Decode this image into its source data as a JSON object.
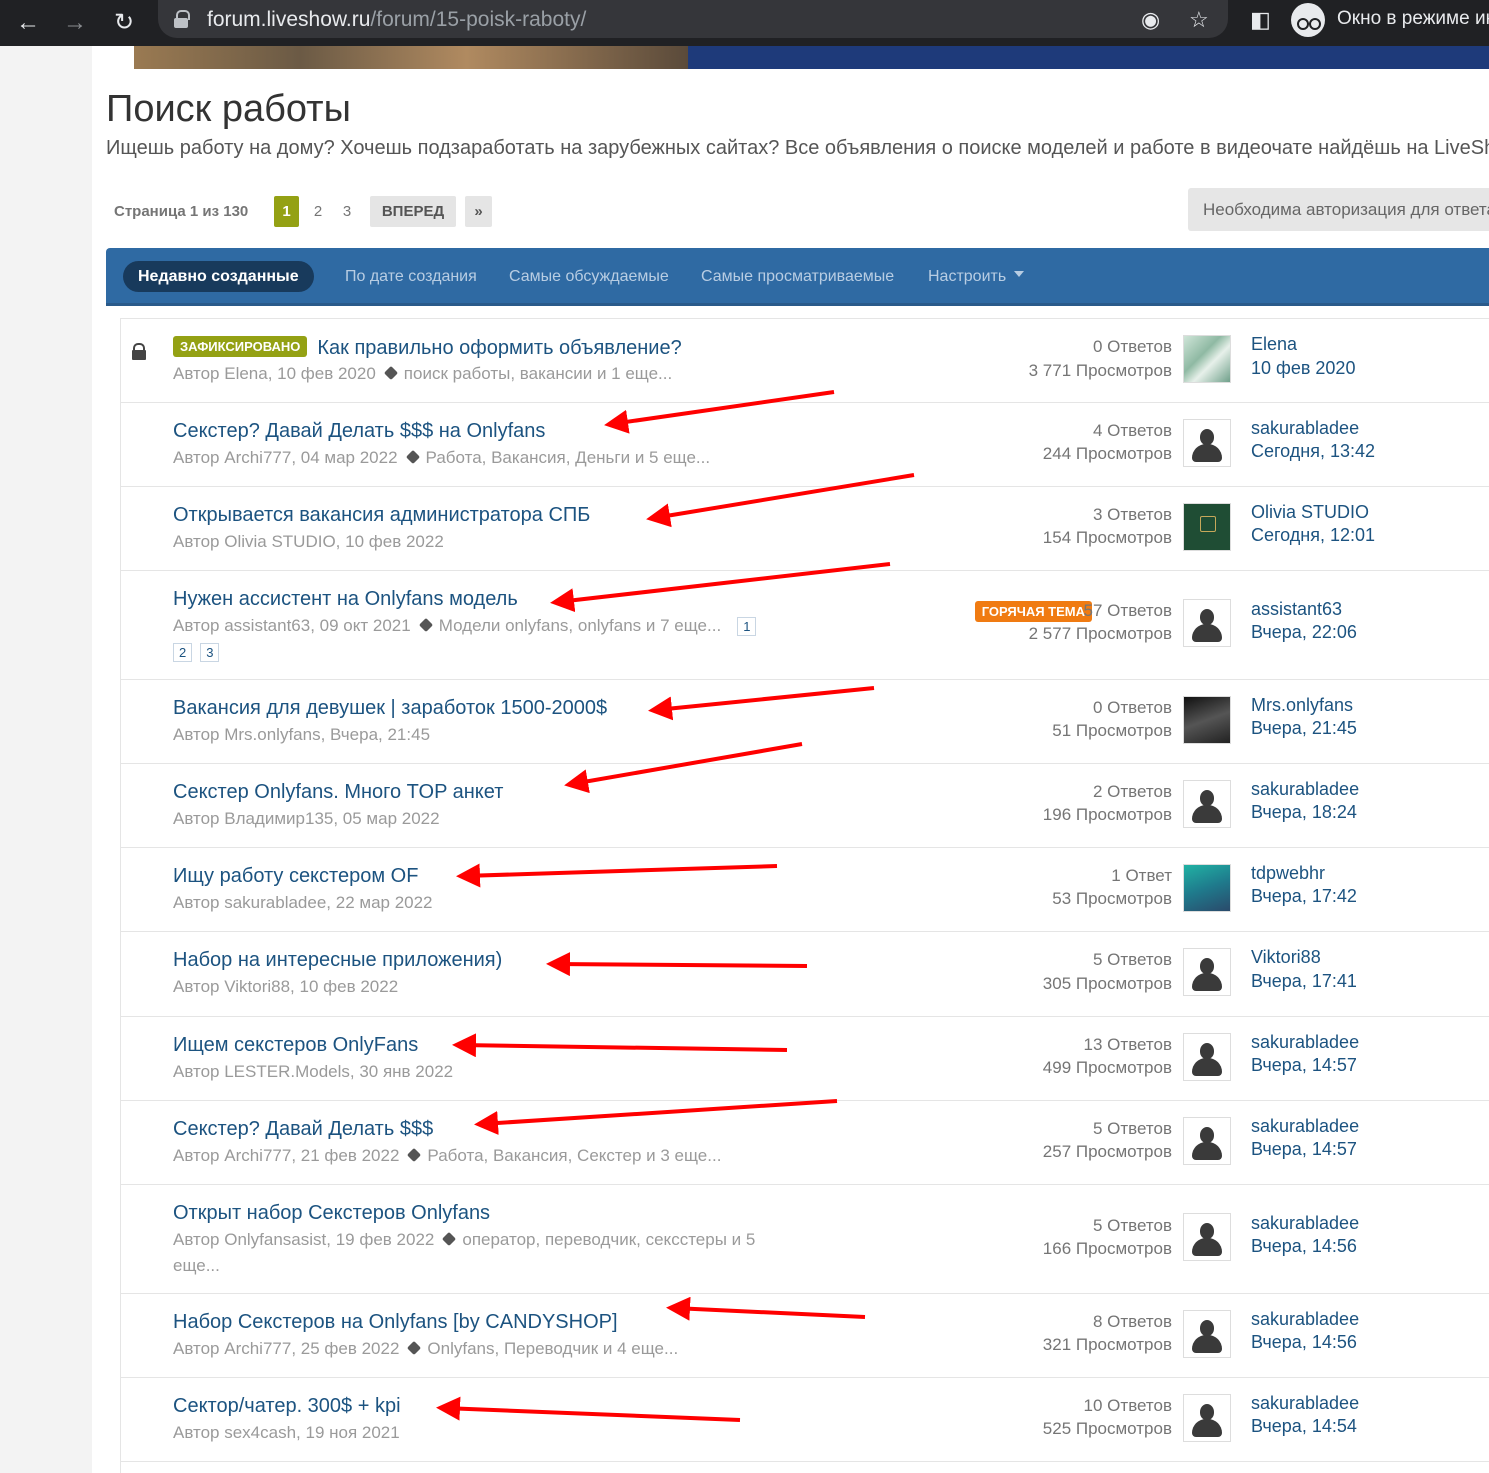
{
  "browser": {
    "url_host": "forum.liveshow.ru",
    "url_path": "/forum/15-poisk-raboty/",
    "incognito_label": "Окно в режиме ин"
  },
  "page": {
    "title": "Поиск работы",
    "description": "Ищешь работу на дому? Хочешь подзаработать на зарубежных сайтах? Все объявления о поиске моделей и работе в видеочате найдёшь на LiveShow"
  },
  "pagination": {
    "info": "Страница 1 из 130",
    "pages": [
      "1",
      "2",
      "3"
    ],
    "next": "ВПЕРЕД",
    "last": "»"
  },
  "auth_button": "Необходима авторизация для ответа",
  "tabs": [
    "Недавно созданные",
    "По дате создания",
    "Самые обсуждаемые",
    "Самые просматриваемые",
    "Настроить"
  ],
  "topics": [
    {
      "pinned": "ЗАФИКСИРОВАНО",
      "title": "Как правильно оформить объявление?",
      "author": "Автор Elena, 10 фев 2020",
      "tags": "поиск работы, вакансии и 1 еще...",
      "replies": "0 Ответов",
      "views": "3 771 Просмотров",
      "last_user": "Elena",
      "last_date": "10 фев 2020",
      "avatar": "leaves-avatar"
    },
    {
      "title": "Секстер? Давай Делать $$$ на Onlyfans",
      "author": "Автор Archi777, 04 мар 2022",
      "tags": "Работа, Вакансия, Деньги и 5 еще...",
      "replies": "4 Ответов",
      "views": "244 Просмотров",
      "last_user": "sakurabladee",
      "last_date": "Сегодня, 13:42",
      "avatar": "default-avatar"
    },
    {
      "title": "Открывается вакансия администратора СПБ",
      "author": "Автор Olivia STUDIO, 10 фев 2022",
      "replies": "3 Ответов",
      "views": "154 Просмотров",
      "last_user": "Olivia STUDIO",
      "last_date": "Сегодня, 12:01",
      "avatar": "studio-logo-avatar"
    },
    {
      "title": "Нужен ассистент на Onlyfans модель",
      "author": "Автор assistant63, 09 окт 2021",
      "tags": "Модели onlyfans, onlyfans и 7 еще...",
      "page_links": [
        "1",
        "2",
        "3"
      ],
      "hot": "ГОРЯЧАЯ ТЕМА",
      "replies": "57 Ответов",
      "views": "2 577 Просмотров",
      "last_user": "assistant63",
      "last_date": "Вчера, 22:06",
      "avatar": "default-avatar"
    },
    {
      "title": "Вакансия для девушек | заработок 1500-2000$",
      "author": "Автор Mrs.onlyfans, Вчера, 21:45",
      "replies": "0 Ответов",
      "views": "51 Просмотров",
      "last_user": "Mrs.onlyfans",
      "last_date": "Вчера, 21:45",
      "avatar": "photo-avatar"
    },
    {
      "title": "Секстер Onlyfans. Много TOP анкет",
      "author": "Автор Владимир135, 05 мар 2022",
      "replies": "2 Ответов",
      "views": "196 Просмотров",
      "last_user": "sakurabladee",
      "last_date": "Вчера, 18:24",
      "avatar": "default-avatar"
    },
    {
      "title": "Ищу работу секстером OF",
      "author": "Автор sakurabladee, 22 мар 2022",
      "replies": "1 Ответ",
      "views": "53 Просмотров",
      "last_user": "tdpwebhr",
      "last_date": "Вчера, 17:42",
      "avatar": "illustration-avatar"
    },
    {
      "title": "Набор на интересные приложения)",
      "author": "Автор Viktori88, 10 фев 2022",
      "replies": "5 Ответов",
      "views": "305 Просмотров",
      "last_user": "Viktori88",
      "last_date": "Вчера, 17:41",
      "avatar": "default-avatar"
    },
    {
      "title": "Ищем секстеров OnlyFans",
      "author": "Автор LESTER.Models, 30 янв 2022",
      "replies": "13 Ответов",
      "views": "499 Просмотров",
      "last_user": "sakurabladee",
      "last_date": "Вчера, 14:57",
      "avatar": "default-avatar"
    },
    {
      "title": "Секстер? Давай Делать $$$",
      "author": "Автор Archi777, 21 фев 2022",
      "tags": "Работа, Вакансия, Секстер и 3 еще...",
      "replies": "5 Ответов",
      "views": "257 Просмотров",
      "last_user": "sakurabladee",
      "last_date": "Вчера, 14:57",
      "avatar": "default-avatar"
    },
    {
      "title": "Открыт набор Секстеров Onlyfans",
      "author": "Автор Onlyfansasist, 19 фев 2022",
      "tags": "оператор, переводчик, сексстеры и 5",
      "tags_cont": "еще...",
      "replies": "5 Ответов",
      "views": "166 Просмотров",
      "last_user": "sakurabladee",
      "last_date": "Вчера, 14:56",
      "avatar": "default-avatar"
    },
    {
      "title": "Набор Секстеров на Onlyfans [by CANDYSHOP]",
      "author": "Автор Archi777, 25 фев 2022",
      "tags": "Onlyfans, Переводчик и 4 еще...",
      "replies": "8 Ответов",
      "views": "321 Просмотров",
      "last_user": "sakurabladee",
      "last_date": "Вчера, 14:56",
      "avatar": "default-avatar"
    },
    {
      "title": "Сектор/чатер. 300$ + kpi",
      "author": "Автор sex4cash, 19 ноя 2021",
      "replies": "10 Ответов",
      "views": "525 Просмотров",
      "last_user": "sakurabladee",
      "last_date": "Вчера, 14:54",
      "avatar": "default-avatar"
    }
  ],
  "colors": {
    "accent_green": "#94a114",
    "tab_bar": "#2f6aa3",
    "hot_badge": "#f07b12",
    "annotation_arrow": "#ff0000",
    "link": "#1c5380"
  }
}
